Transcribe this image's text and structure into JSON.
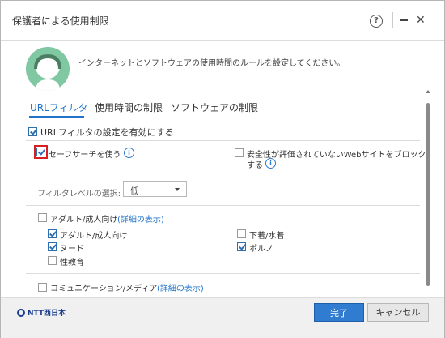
{
  "window": {
    "title": "保護者による使用制限"
  },
  "header": {
    "description": "インターネットとソフトウェアの使用時間のルールを設定してください。"
  },
  "tabs": [
    {
      "label": "URLフィルタ",
      "active": true
    },
    {
      "label": "使用時間の制限",
      "active": false
    },
    {
      "label": "ソフトウェアの制限",
      "active": false
    }
  ],
  "url_filter": {
    "enable_label": "URLフィルタの設定を有効にする",
    "enable_checked": true,
    "safe_search_label": "セーフサーチを使う",
    "safe_search_checked": true,
    "block_unrated_label_line1": "安全性が評価されていないWebサイトをブロック",
    "block_unrated_label_line2": "する",
    "block_unrated_checked": false,
    "filter_level_label": "フィルタレベルの選択:",
    "filter_level_value": "低",
    "categories": {
      "adult": {
        "label": "アダルト/成人向け",
        "details_link": "(詳細の表示)",
        "items": [
          {
            "label": "アダルト/成人向け",
            "checked": true
          },
          {
            "label": "下着/水着",
            "checked": false
          },
          {
            "label": "ヌード",
            "checked": true
          },
          {
            "label": "ポルノ",
            "checked": true
          },
          {
            "label": "性教育",
            "checked": false
          }
        ]
      },
      "communication": {
        "label": "コミュニケーション/メディア",
        "details_link": "(詳細の表示)"
      }
    }
  },
  "footer": {
    "logo_text": "NTT西日本",
    "ok_label": "完了",
    "cancel_label": "キャンセル"
  },
  "colors": {
    "accent": "#1f73c8",
    "primary_button": "#2f7cd0",
    "avatar": "#7fc8a1",
    "highlight": "#d92020"
  }
}
